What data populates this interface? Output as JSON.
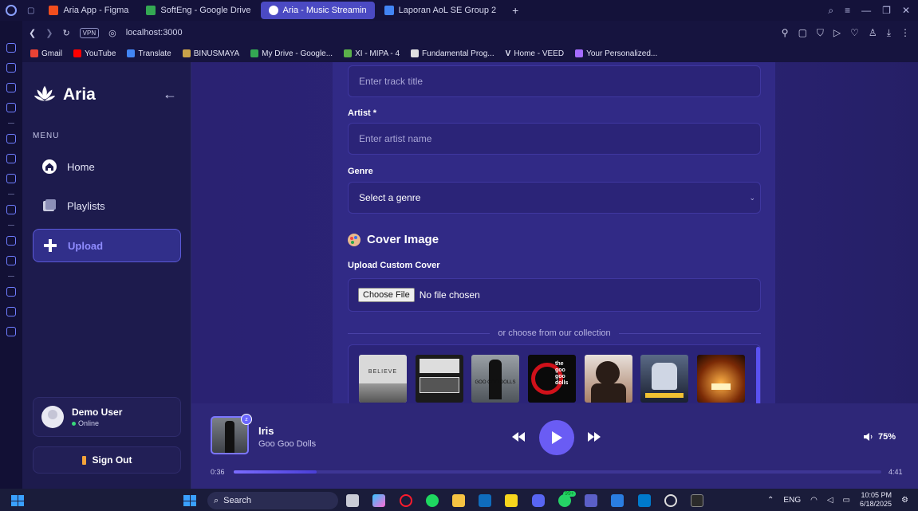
{
  "browser": {
    "tabs": [
      {
        "label": "Aria App - Figma",
        "color": "#f24e1e"
      },
      {
        "label": "SoftEng - Google Drive",
        "color": "#34a853"
      },
      {
        "label": "Aria - Music Streamin",
        "color": "#ffffff"
      },
      {
        "label": "Laporan AoL SE Group 2",
        "color": "#4285f4"
      }
    ],
    "vpn_label": "VPN",
    "url": "localhost:3000",
    "bookmarks": [
      {
        "label": "Gmail",
        "color": "#ea4335"
      },
      {
        "label": "YouTube",
        "color": "#ff0000"
      },
      {
        "label": "Translate",
        "color": "#4285f4"
      },
      {
        "label": "BINUSMAYA",
        "color": "#c9a24a"
      },
      {
        "label": "My Drive - Google...",
        "color": "#34a853"
      },
      {
        "label": "XI - MIPA - 4",
        "color": "#5bb04a"
      },
      {
        "label": "Fundamental Prog...",
        "color": "#e0e0e0"
      },
      {
        "label": "Home - VEED",
        "color": "#ffffff"
      },
      {
        "label": "Your Personalized...",
        "color": "#a56cff"
      }
    ]
  },
  "sidebar": {
    "brand": "Aria",
    "collapse": "←",
    "menu_label": "MENU",
    "items": [
      {
        "label": "Home",
        "icon": "home-icon"
      },
      {
        "label": "Playlists",
        "icon": "playlists-icon"
      },
      {
        "label": "Upload",
        "icon": "plus-icon",
        "active": true
      }
    ],
    "user": {
      "name": "Demo User",
      "status": "Online"
    },
    "signout": "Sign Out"
  },
  "form": {
    "title_placeholder": "Enter track title",
    "artist_label": "Artist *",
    "artist_placeholder": "Enter artist name",
    "genre_label": "Genre",
    "genre_value": "Select a genre",
    "cover_section": "Cover Image",
    "upload_label": "Upload Custom Cover",
    "choose_file": "Choose File",
    "no_file": "No file chosen",
    "collection_divider": "or choose from our collection",
    "covers": [
      {
        "name": "believe-cover",
        "text": "BELIEVE",
        "bg": "#d9d9d9",
        "fg": "#333333"
      },
      {
        "name": "cover-2",
        "text": "",
        "bg": "#1b1b1b",
        "fg": "#dddddd"
      },
      {
        "name": "goo-goo-dolls-cover",
        "text": "GOO GOO DOLLS",
        "bg": "#7a7f86",
        "fg": "#111111"
      },
      {
        "name": "goo-goo-dolls-red-cover",
        "text": "the goo goo dolls",
        "bg": "#0a0a0a",
        "fg": "#ffffff"
      },
      {
        "name": "portrait-cover",
        "text": "",
        "bg": "#c9a690",
        "fg": "#222222"
      },
      {
        "name": "metal-cover",
        "text": "",
        "bg": "#2a3448",
        "fg": "#f1c232"
      },
      {
        "name": "fire-cover",
        "text": "",
        "bg": "#3b1a08",
        "fg": "#ffb347"
      }
    ]
  },
  "player": {
    "title": "Iris",
    "artist": "Goo Goo Dolls",
    "badge": "z",
    "volume": "75%",
    "current": "0:36",
    "total": "4:41",
    "progress": 0.128
  },
  "taskbar": {
    "search": "Search",
    "lang": "ENG",
    "time": "10:05 PM",
    "date": "6/18/2025",
    "badge": "99+"
  }
}
